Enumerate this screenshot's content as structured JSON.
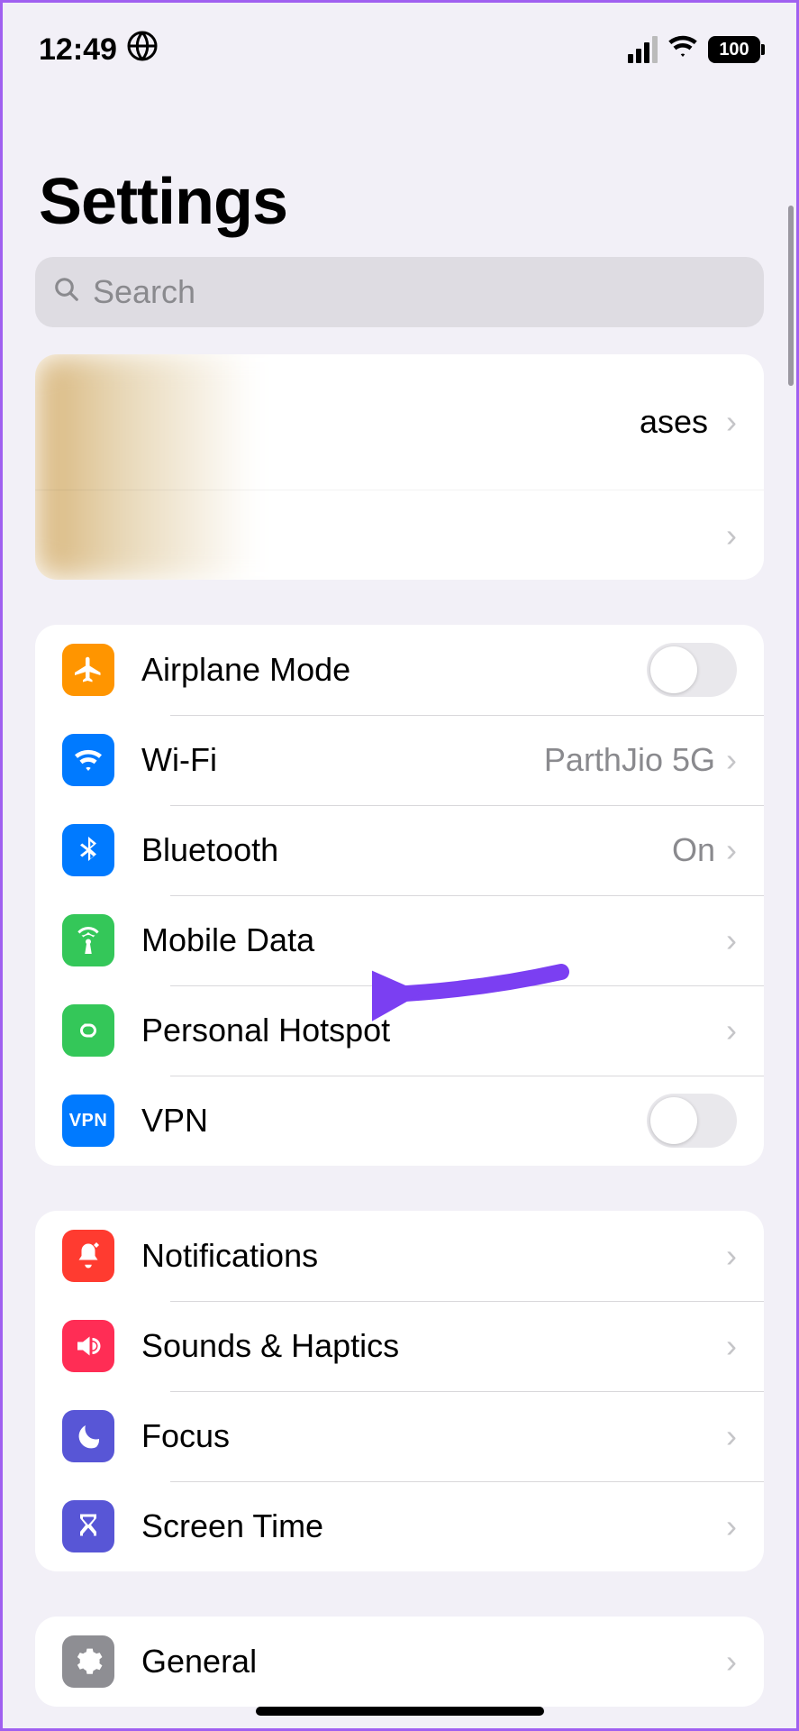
{
  "status": {
    "time": "12:49",
    "battery": "100"
  },
  "title": "Settings",
  "search": {
    "placeholder": "Search"
  },
  "account": {
    "partial_label": "ases"
  },
  "groups": [
    {
      "id": "connectivity",
      "rows": [
        {
          "id": "airplane",
          "label": "Airplane Mode",
          "icon": "airplane",
          "icon_bg": "#ff9500",
          "control": "toggle"
        },
        {
          "id": "wifi",
          "label": "Wi-Fi",
          "value": "ParthJio 5G",
          "icon": "wifi",
          "icon_bg": "#007aff",
          "control": "disclosure"
        },
        {
          "id": "bluetooth",
          "label": "Bluetooth",
          "value": "On",
          "icon": "bluetooth",
          "icon_bg": "#007aff",
          "control": "disclosure"
        },
        {
          "id": "mobile",
          "label": "Mobile Data",
          "icon": "antenna",
          "icon_bg": "#34c759",
          "control": "disclosure"
        },
        {
          "id": "hotspot",
          "label": "Personal Hotspot",
          "icon": "link",
          "icon_bg": "#34c759",
          "control": "disclosure"
        },
        {
          "id": "vpn",
          "label": "VPN",
          "icon": "vpn",
          "icon_bg": "#007aff",
          "control": "toggle"
        }
      ]
    },
    {
      "id": "attention",
      "rows": [
        {
          "id": "notifications",
          "label": "Notifications",
          "icon": "bell",
          "icon_bg": "#ff3b30",
          "control": "disclosure"
        },
        {
          "id": "sounds",
          "label": "Sounds & Haptics",
          "icon": "speaker",
          "icon_bg": "#ff2d55",
          "control": "disclosure"
        },
        {
          "id": "focus",
          "label": "Focus",
          "icon": "moon",
          "icon_bg": "#5856d6",
          "control": "disclosure"
        },
        {
          "id": "screentime",
          "label": "Screen Time",
          "icon": "hourglass",
          "icon_bg": "#5856d6",
          "control": "disclosure"
        }
      ]
    },
    {
      "id": "system",
      "rows": [
        {
          "id": "general",
          "label": "General",
          "icon": "gear",
          "icon_bg": "#8e8e93",
          "control": "disclosure"
        }
      ]
    }
  ]
}
